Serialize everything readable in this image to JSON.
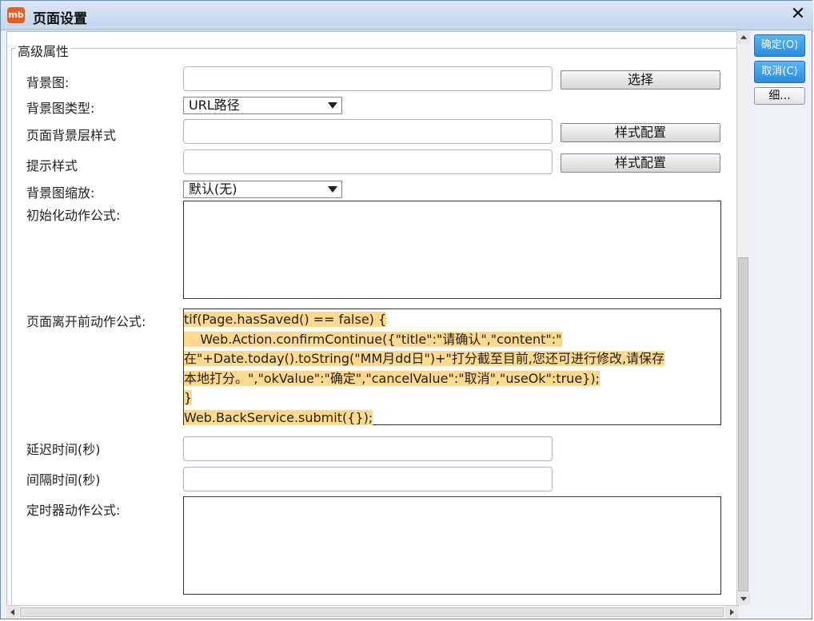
{
  "window": {
    "title": "页面设置",
    "app_icon_text": "mb"
  },
  "group": {
    "title": "高级属性"
  },
  "fields": {
    "background_image_label": "背景图:",
    "background_image_button": "选择",
    "background_type_label": "背景图类型:",
    "background_type_value": "URL路径",
    "page_bg_style_label": "页面背景层样式",
    "page_bg_style_button": "样式配置",
    "hint_style_label": "提示样式",
    "hint_style_button": "样式配置",
    "bg_scale_label": "背景图缩放:",
    "bg_scale_value": "默认(无)",
    "init_formula_label": "初始化动作公式:",
    "leave_formula_label": "页面离开前动作公式:",
    "leave_formula_lines": [
      "tif(Page.hasSaved() == false) {",
      "    Web.Action.confirmContinue({\"title\":\"请确认\",\"content\":\"",
      "在\"+Date.today().toString(\"MM月dd日\")+\"打分截至目前,您还可进行修改,请保存",
      "本地打分。\",\"okValue\":\"确定\",\"cancelValue\":\"取消\",\"useOk\":true});",
      "}",
      "Web.BackService.submit({});"
    ],
    "delay_label": "延迟时间(秒)",
    "interval_label": "间隔时间(秒)",
    "timer_formula_label": "定时器动作公式:"
  },
  "side_buttons": {
    "ok": "确定(O)",
    "cancel": "取消(C)",
    "detail": "细..."
  },
  "colors": {
    "highlight": "#fdd88f",
    "primary_button": "#2a8ede"
  }
}
